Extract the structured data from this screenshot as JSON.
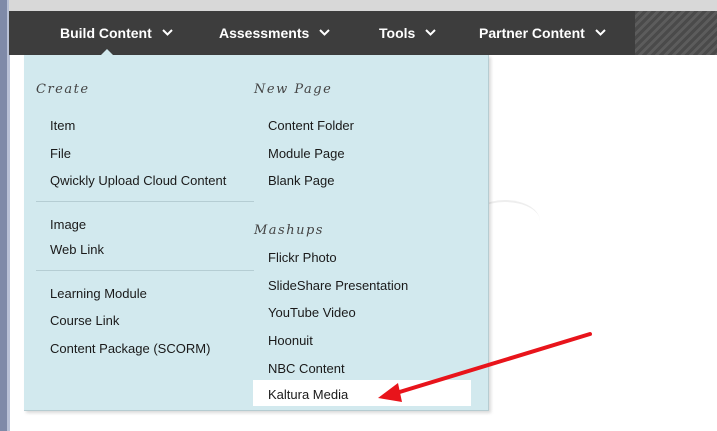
{
  "nav": {
    "tabs": [
      {
        "label": "Build Content"
      },
      {
        "label": "Assessments"
      },
      {
        "label": "Tools"
      },
      {
        "label": "Partner Content"
      }
    ]
  },
  "menu": {
    "create": {
      "heading": "Create",
      "group1": [
        "Item",
        "File",
        "Qwickly Upload Cloud Content"
      ],
      "group2": [
        "Image",
        "Web Link"
      ],
      "group3": [
        "Learning Module",
        "Course Link",
        "Content Package (SCORM)"
      ]
    },
    "new_page": {
      "heading": "New Page",
      "items": [
        "Content Folder",
        "Module Page",
        "Blank Page"
      ]
    },
    "mashups": {
      "heading": "Mashups",
      "items": [
        "Flickr Photo",
        "SlideShare Presentation",
        "YouTube Video",
        "Hoonuit",
        "NBC Content",
        "Kaltura Media"
      ]
    }
  },
  "colors": {
    "nav_bg": "#3d3d3d",
    "menu_bg": "#d2e9ee",
    "highlight": "#ffffff",
    "annotation_arrow": "#e8141b"
  },
  "icons": {
    "tab_chevron": "chevron-down-icon",
    "annotation": "red-arrow-icon"
  }
}
